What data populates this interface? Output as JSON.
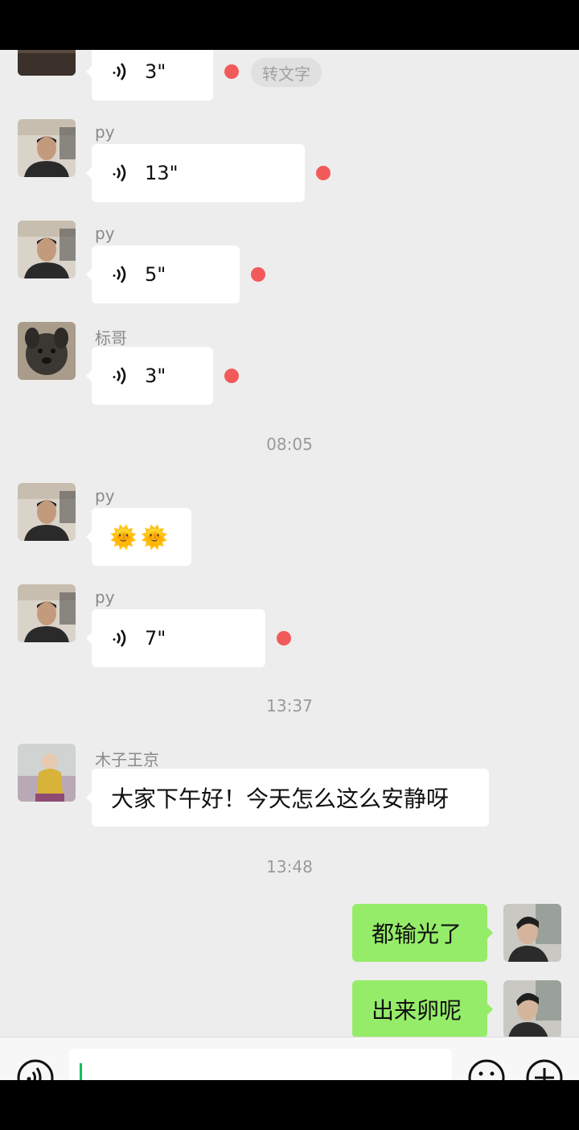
{
  "messages": [
    {
      "type": "voice",
      "duration": "3\"",
      "to_text": "转文字"
    },
    {
      "sender": "py",
      "type": "voice",
      "duration": "13\""
    },
    {
      "sender": "py",
      "type": "voice",
      "duration": "5\""
    },
    {
      "sender": "标哥",
      "type": "voice",
      "duration": "3\""
    },
    {
      "sender": "py",
      "type": "emoji",
      "emoji": "🌞🌞"
    },
    {
      "sender": "py",
      "type": "voice",
      "duration": "7\""
    },
    {
      "sender": "木子王京",
      "type": "text",
      "text": "大家下午好！今天怎么这么安静呀"
    },
    {
      "sender": "me",
      "type": "text",
      "text": "都输光了"
    },
    {
      "sender": "me",
      "type": "text",
      "text": "出来卵呢"
    }
  ],
  "timestamps": [
    "08:05",
    "13:37",
    "13:48"
  ],
  "input": {
    "value": ""
  },
  "icons": {
    "voice": "voice-wave-icon",
    "unread": "unread-dot-icon",
    "voice_mode": "voice-mode-icon",
    "emoji": "emoji-icon",
    "more": "plus-icon"
  },
  "colors": {
    "chat_bg": "#ededed",
    "my_bubble": "#95ec69",
    "other_bubble": "#ffffff",
    "unread_dot": "#f25a5a",
    "caret": "#07c160"
  }
}
